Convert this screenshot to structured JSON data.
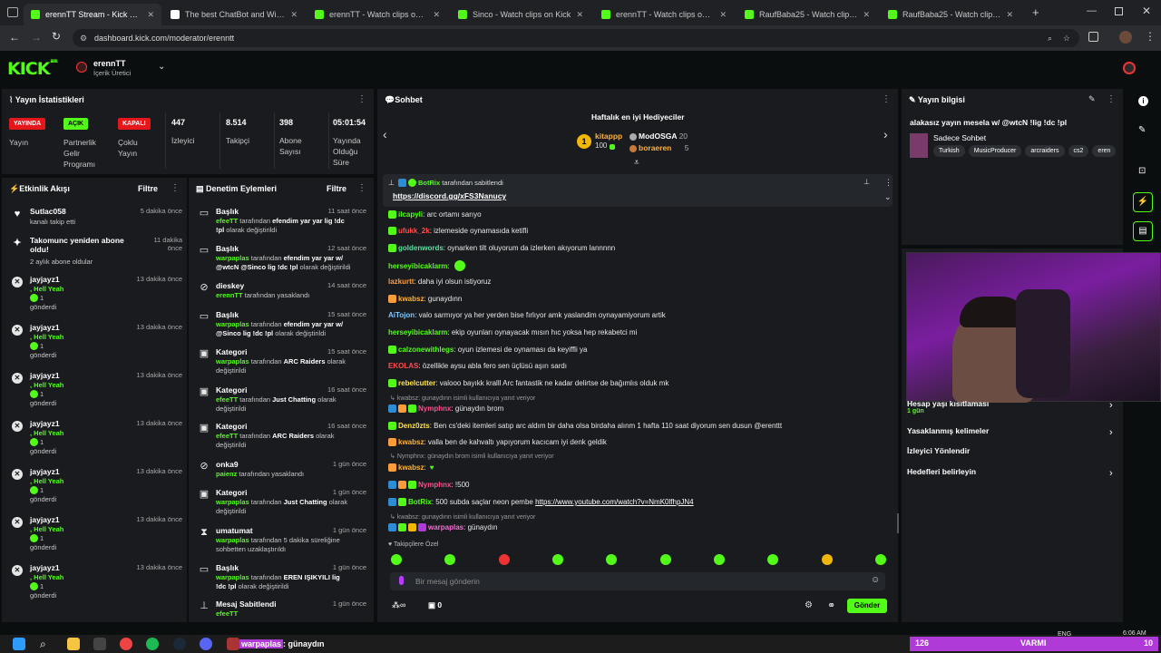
{
  "browser": {
    "tabs": [
      {
        "title": "erennTT Stream - Kick Dashboard"
      },
      {
        "title": "The best ChatBot and Widgets"
      },
      {
        "title": "erennTT - Watch clips on Kick"
      },
      {
        "title": "Sinco - Watch clips on Kick"
      },
      {
        "title": "erennTT - Watch clips on Kick"
      },
      {
        "title": "RaufBaba25 - Watch clips on Kick"
      },
      {
        "title": "RaufBaba25 - Watch clips on Kick"
      }
    ],
    "url": "dashboard.kick.com/moderator/erenntt"
  },
  "header": {
    "logo": "KICK",
    "logo_sup": "BETA",
    "channel_name": "erennTT",
    "channel_role": "İçerik Üretici"
  },
  "stats": {
    "title": "Yayın İstatistikleri",
    "items": [
      {
        "badge": "YAYINDA",
        "label": "Yayın"
      },
      {
        "badge": "AÇIK",
        "label": "Partnerlik Gelir Programı"
      },
      {
        "badge": "KAPALI",
        "label": "Çoklu Yayın"
      },
      {
        "value": "447",
        "label": "İzleyici"
      },
      {
        "value": "8.514",
        "label": "Takipçi"
      },
      {
        "value": "398",
        "label": "Abone Sayısı"
      },
      {
        "value": "05:01:54",
        "label": "Yayında Olduğu Süre"
      }
    ]
  },
  "activity": {
    "title": "Etkinlik Akışı",
    "filter": "Filtre",
    "items": [
      {
        "name": "Sutlac058",
        "sub": "kanalı takip etti",
        "time": "5 dakika önce"
      },
      {
        "name": "Takomunc yeniden abone oldu!",
        "sub": "2 aylık abone oldular",
        "time": "11 dakika önce"
      },
      {
        "name": "jayjayz1",
        "gift": ", Hell Yeah",
        "count": "1",
        "sent": "gönderdi",
        "time": "13 dakika önce"
      },
      {
        "name": "jayjayz1",
        "gift": ", Hell Yeah",
        "count": "1",
        "sent": "gönderdi",
        "time": "13 dakika önce"
      },
      {
        "name": "jayjayz1",
        "gift": ", Hell Yeah",
        "count": "1",
        "sent": "gönderdi",
        "time": "13 dakika önce"
      },
      {
        "name": "jayjayz1",
        "gift": ", Hell Yeah",
        "count": "1",
        "sent": "gönderdi",
        "time": "13 dakika önce"
      },
      {
        "name": "jayjayz1",
        "gift": ", Hell Yeah",
        "count": "1",
        "sent": "gönderdi",
        "time": "13 dakika önce"
      },
      {
        "name": "jayjayz1",
        "gift": ", Hell Yeah",
        "count": "1",
        "sent": "gönderdi",
        "time": "13 dakika önce"
      },
      {
        "name": "jayjayz1",
        "gift": ", Hell Yeah",
        "count": "1",
        "sent": "gönderdi",
        "time": "13 dakika önce"
      }
    ]
  },
  "moderation": {
    "title": "Denetim Eylemleri",
    "filter": "Filtre",
    "items": [
      {
        "name": "Başlık",
        "time": "11 saat önce",
        "user": "efeeTT",
        "mid": " tarafından ",
        "val": "efendim yar yar lig !dc !pl",
        "end": " olarak değiştirildi"
      },
      {
        "name": "Başlık",
        "time": "12 saat önce",
        "user": "warpaplas",
        "mid": " tarafından ",
        "val": "efendim yar yar w/ @wtcN @Sinco lig !dc !pl",
        "end": " olarak değiştirildi"
      },
      {
        "name": "dieskey",
        "time": "14 saat önce",
        "user": "erennTT",
        "mid": " tarafından yasaklandı",
        "val": "",
        "end": ""
      },
      {
        "name": "Başlık",
        "time": "15 saat önce",
        "user": "warpaplas",
        "mid": " tarafından ",
        "val": "efendim yar yar w/ @Sinco lig !dc !pl",
        "end": " olarak değiştirildi"
      },
      {
        "name": "Kategori",
        "time": "15 saat önce",
        "user": "warpaplas",
        "mid": " tarafından ",
        "val": "ARC Raiders",
        "end": " olarak değiştirildi"
      },
      {
        "name": "Kategori",
        "time": "16 saat önce",
        "user": "efeeTT",
        "mid": " tarafından ",
        "val": "Just Chatting",
        "end": " olarak değiştirildi"
      },
      {
        "name": "Kategori",
        "time": "16 saat önce",
        "user": "efeeTT",
        "mid": " tarafından ",
        "val": "ARC Raiders",
        "end": " olarak değiştirildi"
      },
      {
        "name": "onka9",
        "time": "1 gün önce",
        "user": "paienz",
        "mid": " tarafından yasaklandı",
        "val": "",
        "end": ""
      },
      {
        "name": "Kategori",
        "time": "1 gün önce",
        "user": "warpaplas",
        "mid": " tarafından ",
        "val": "Just Chatting",
        "end": " olarak değiştirildi"
      },
      {
        "name": "umatumat",
        "time": "1 gün önce",
        "user": "warpaplas",
        "mid": " tarafından 5 dakika süreliğine sohbetten uzaklaştırıldı",
        "val": "",
        "end": ""
      },
      {
        "name": "Başlık",
        "time": "1 gün önce",
        "user": "warpaplas",
        "mid": " tarafından ",
        "val": "EREN IŞIKYILI lig !dc !pl",
        "end": " olarak değiştirildi"
      },
      {
        "name": "Mesaj Sabitlendi",
        "time": "1 gün önce",
        "user": "efeeTT",
        "mid": "",
        "val": "",
        "end": ""
      }
    ]
  },
  "chat": {
    "title": "Sohbet",
    "top_gifters_title": "Haftalık en iyi Hediyeciler",
    "gifters": [
      {
        "rank": "1",
        "name": "kitappp",
        "amount": "100"
      },
      {
        "name": "ModOSGA",
        "amount": "20"
      },
      {
        "name": "boraeren",
        "amount": "5"
      }
    ],
    "pinned_by": "BotRix",
    "pinned_suffix": " tarafından sabitlendi",
    "pinned_link": "https://discord.gg/xFS3Nanucy",
    "messages": [
      {
        "user": "ilcapyli",
        "color": "#53fc18",
        "text": ": arc ortamı sarıyo"
      },
      {
        "user": "ufukk_2k",
        "color": "#ff4d4d",
        "text": ": izlemeside oynamasıda ketifli"
      },
      {
        "user": "goldenwords",
        "color": "#58e0a0",
        "text": ": oynarken tilt oluyorum da izlerken akıyorum lannnnn"
      },
      {
        "user": "herseyibicaklarm",
        "color": "#53fc18",
        "text": ":"
      },
      {
        "user": "lazkurtt",
        "color": "#ff9c3a",
        "text": ": daha iyi olsun istiyoruz"
      },
      {
        "user": "kwabsz",
        "color": "#ffb13a",
        "text": ": gunaydınn"
      },
      {
        "user": "AiTojon",
        "color": "#7ec8ff",
        "text": ": valo sarmıyor ya her yerden bise fırlıyor amk yaslandim oynayamiyorum artik"
      },
      {
        "user": "herseyibicaklarm",
        "color": "#53fc18",
        "text": ": ekip oyunları oynayacak mısın hıc yoksa hep rekabetci mi"
      },
      {
        "user": "calzonewithlegs",
        "color": "#53fc18",
        "text": ": oyun izlemesi de oynaması da keyiffli ya"
      },
      {
        "user": "EKOLAS",
        "color": "#ff4d4d",
        "text": ": özellikle aysu abla fero sen üçlüsü aşırı sardı"
      },
      {
        "user": "rebelcutter",
        "color": "#ffe14d",
        "text": ": valooo bayıkk kralll Arc fantastik ne kadar delirtse de bağımlıs olduk mk"
      },
      {
        "reply": "kwabsz: gunaydınn isimli kullanıcıya yanıt veriyor"
      },
      {
        "user": "Nymphnx",
        "color": "#ff4d8d",
        "text": ": günaydın brom"
      },
      {
        "user": "Denz0zts",
        "color": "#ffe14d",
        "text": ": Ben cs'deki itemleri satıp arc aldım bir daha olsa birdaha alınm 1 hafta 110 saat diyorum sen dusun @erenttt"
      },
      {
        "user": "kwabsz",
        "color": "#ffb13a",
        "text": ": valla ben de kahvaltı yapıyorum kacıcam iyi denk geldik"
      },
      {
        "reply": "Nymphnx: günaydın brom isimli kullanıcıya yanıt veriyor"
      },
      {
        "user": "kwabsz",
        "color": "#ffb13a",
        "text": ":"
      },
      {
        "user": "Nymphnx",
        "color": "#ff4d8d",
        "text": ": !500"
      },
      {
        "user": "BotRix",
        "color": "#53fc18",
        "text": ": 500 subda saçlar neon pembe ",
        "link": "https://www.youtube.com/watch?v=NmK0lfhpJN4"
      },
      {
        "reply": "kwabsz: gunaydınn isimli kullanıcıya yanıt veriyor"
      },
      {
        "user": "warpaplas",
        "color": "#ff66d9",
        "text": ": günaydın"
      }
    ],
    "followers_only": "Takipçilere Özel",
    "input_placeholder": "Bir mesaj gönderin",
    "bottom_count": "0",
    "send_label": "Gönder"
  },
  "stream_info": {
    "title": "Yayın bilgisi",
    "stream_title": "alakasız yayın mesela w/ @wtcN !lig !dc !pl",
    "chat_mode": "Sadece Sohbet",
    "tags": [
      "Turkish",
      "MusicProducer",
      "arcraiders",
      "cs2",
      "eren"
    ],
    "items": [
      {
        "label": "Hesap yaşı kısıtlaması",
        "sub": "1 gün"
      },
      {
        "label": "Yasaklanmış kelimeler"
      },
      {
        "label": "İzleyici Yönlendir"
      },
      {
        "label": "Hedefleri belirleyin"
      }
    ]
  },
  "taskbar": {
    "overlay_user": "warpaplas",
    "overlay_text": ": günaydın",
    "lang": "ENG",
    "time": "6:06 AM",
    "poll_left": "126",
    "poll_mid": "VARMI",
    "poll_right": "10"
  }
}
